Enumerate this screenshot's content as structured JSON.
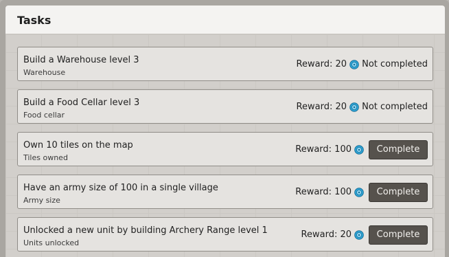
{
  "window": {
    "title": "Tasks"
  },
  "tasks": [
    {
      "title": "Build a Warehouse level 3",
      "subtitle": "Warehouse",
      "reward_label": "Reward: 20",
      "status": "Not completed"
    },
    {
      "title": "Build a Food Cellar level 3",
      "subtitle": "Food cellar",
      "reward_label": "Reward: 20",
      "status": "Not completed"
    },
    {
      "title": "Own 10 tiles on the map",
      "subtitle": "Tiles owned",
      "reward_label": "Reward: 100",
      "button": "Complete"
    },
    {
      "title": "Have an army size of 100 in a single village",
      "subtitle": "Army size",
      "reward_label": "Reward: 100",
      "button": "Complete"
    },
    {
      "title": "Unlocked a new unit by building Archery Range level 1",
      "subtitle": "Units unlocked",
      "reward_label": "Reward: 20",
      "button": "Complete"
    }
  ],
  "icons": {
    "reward": "gem-coin-icon"
  },
  "colors": {
    "button_bg": "#56524d",
    "coin": "#2ea6d9"
  }
}
